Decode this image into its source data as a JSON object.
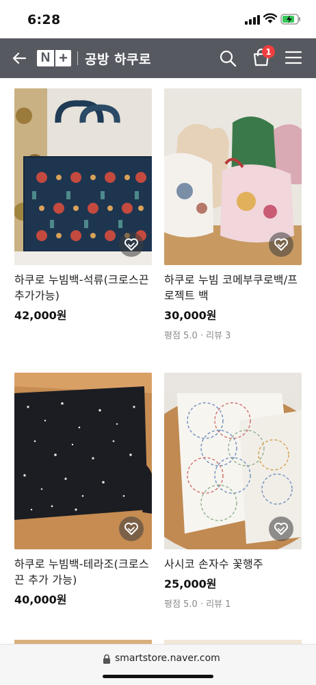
{
  "status_bar": {
    "time": "6:28",
    "icons": [
      "signal-icon",
      "wifi-icon",
      "battery-charging-icon"
    ]
  },
  "header": {
    "logo_n": "N",
    "logo_plus": "+",
    "title": "공방 하쿠로",
    "cart_count": "1",
    "icons": [
      "back-arrow-icon",
      "search-icon",
      "shopping-bag-icon",
      "menu-icon"
    ]
  },
  "products": [
    {
      "name": "하쿠로 누빔백-석류(크로스끈 추가가능)",
      "price": "42,000원",
      "review": ""
    },
    {
      "name": "하쿠로 누빔 코메부쿠로백/프로젝트 백",
      "price": "30,000원",
      "review": "평점 5.0 · 리뷰 3"
    },
    {
      "name": "하쿠로 누빔백-테라조(크로스끈 추가 가능)",
      "price": "40,000원",
      "review": ""
    },
    {
      "name": "사시코 손자수 꽃행주",
      "price": "25,000원",
      "review": "평점 5.0 · 리뷰 1"
    }
  ],
  "url_bar": {
    "url": "smartstore.naver.com"
  },
  "colors": {
    "header_bg": "#56595f",
    "badge": "#f03e3e",
    "text": "#111111",
    "muted": "#8a8a8a"
  }
}
